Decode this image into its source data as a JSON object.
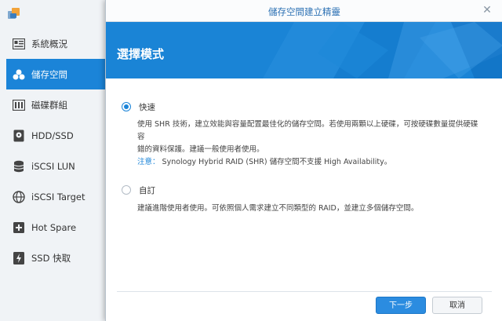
{
  "sidebar": {
    "items": [
      {
        "label": "系統概況",
        "icon": "overview-icon"
      },
      {
        "label": "儲存空間",
        "icon": "storage-pool-icon",
        "active": true
      },
      {
        "label": "磁碟群組",
        "icon": "disk-group-icon"
      },
      {
        "label": "HDD/SSD",
        "icon": "hdd-icon"
      },
      {
        "label": "iSCSI LUN",
        "icon": "lun-icon"
      },
      {
        "label": "iSCSI Target",
        "icon": "target-icon"
      },
      {
        "label": "Hot Spare",
        "icon": "hot-spare-icon"
      },
      {
        "label": "SSD 快取",
        "icon": "ssd-cache-icon"
      }
    ]
  },
  "dialog": {
    "title": "儲存空間建立精靈",
    "banner_title": "選擇模式",
    "options": [
      {
        "label": "快速",
        "checked": true,
        "desc_line1": "使用 SHR 技術，建立效能與容量配置最佳化的儲存空間。若使用兩顆以上硬碟，可按硬碟數量提供硬碟容",
        "desc_line2": "錯的資料保護。建議一般使用者使用。",
        "note_label": "注意：",
        "note_text": " Synology Hybrid RAID (SHR) 儲存空間不支援 High Availability。"
      },
      {
        "label": "自訂",
        "checked": false,
        "desc_line1": "建議進階使用者使用。可依照個人需求建立不同類型的 RAID，並建立多個儲存空間。"
      }
    ],
    "buttons": {
      "next": "下一步",
      "cancel": "取消"
    }
  },
  "colors": {
    "accent": "#1b84d8",
    "banner": "#1a84d6"
  }
}
